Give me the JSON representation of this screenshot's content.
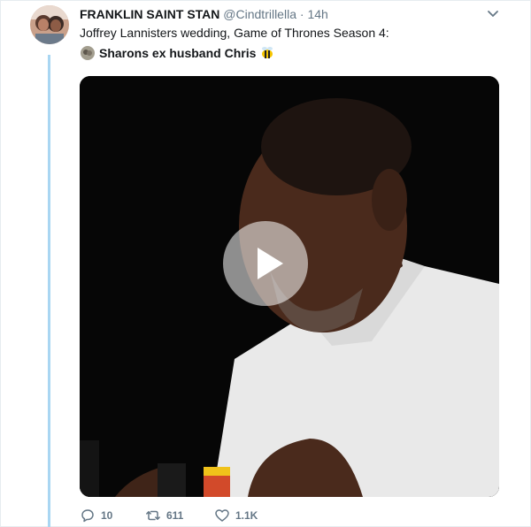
{
  "tweet": {
    "display_name": "FRANKLIN SAINT STAN",
    "handle": "@Cindtrillella",
    "separator": "·",
    "time": "14h",
    "text": "Joffrey Lannisters wedding, Game of Thrones Season 4:",
    "caption": "Sharons ex husband Chris"
  },
  "media": {
    "type": "video",
    "play_icon": "play-icon"
  },
  "actions": {
    "reply_count": "10",
    "retweet_count": "611",
    "like_count": "1.1K"
  },
  "icons": {
    "menu": "chevron-down-icon",
    "reply": "reply-icon",
    "retweet": "retweet-icon",
    "like": "heart-icon",
    "emoji_left": "avatar-emoji-icon",
    "emoji_right": "bee-emoji-icon"
  },
  "colors": {
    "thread_line": "#a9d6f2",
    "secondary_text": "#657786"
  }
}
